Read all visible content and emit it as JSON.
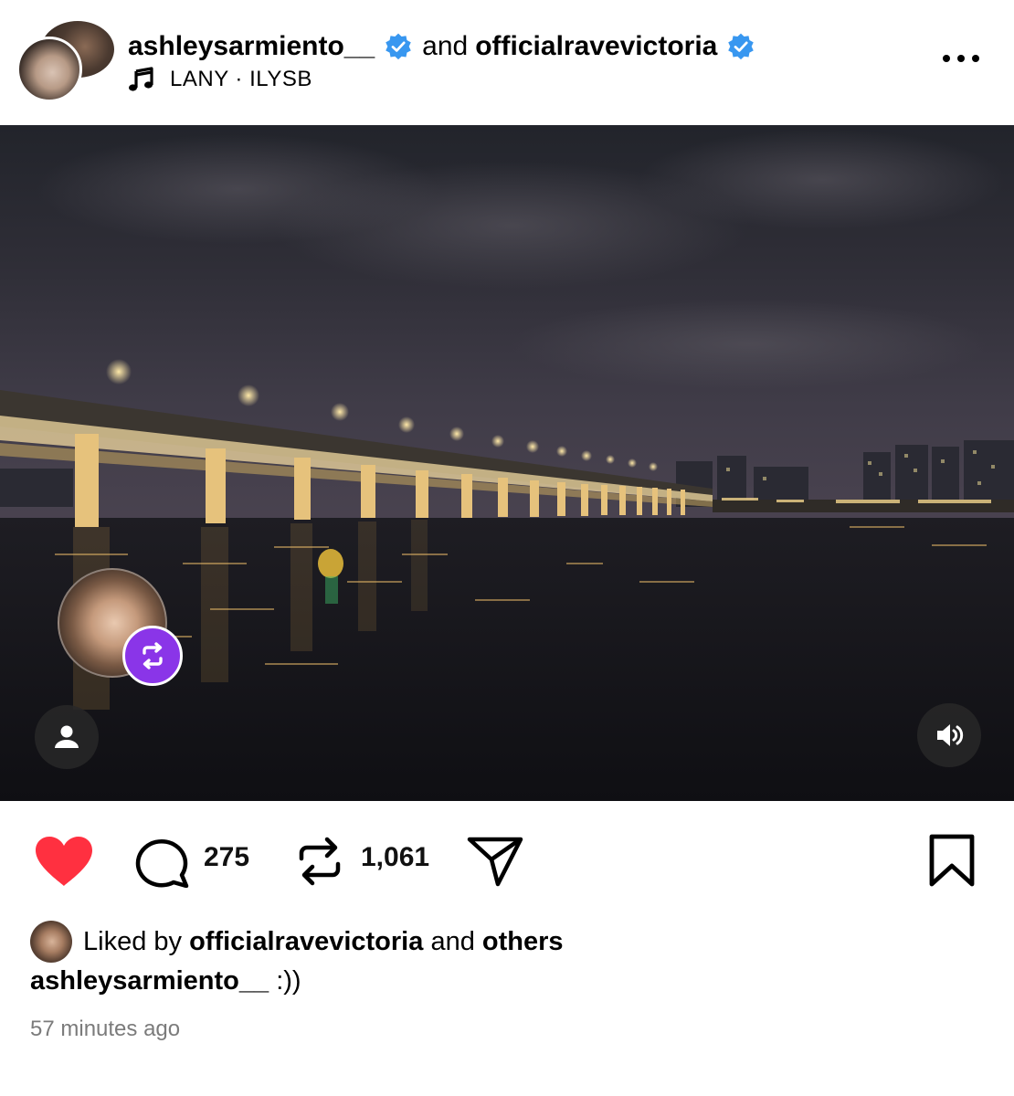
{
  "header": {
    "author": "ashleysarmiento__",
    "and_text": "and",
    "collaborator": "officialravevictoria",
    "music": "LANY · ILYSB",
    "more_label": "•••"
  },
  "media": {
    "reposter_name": "officialravevictoria",
    "tag_icon": "person-icon",
    "sound_icon": "speaker-icon"
  },
  "actions": {
    "comments_count": "275",
    "reposts_count": "1,061"
  },
  "likes": {
    "prefix": "Liked by",
    "user": "officialravevictoria",
    "and_text": "and",
    "others": "others"
  },
  "caption": {
    "user": "ashleysarmiento__",
    "text": ":))"
  },
  "timestamp": "57 minutes ago",
  "colors": {
    "verified_blue": "#3897f0",
    "like_red": "#ff3040",
    "repost_purple": "#8a35e8"
  }
}
